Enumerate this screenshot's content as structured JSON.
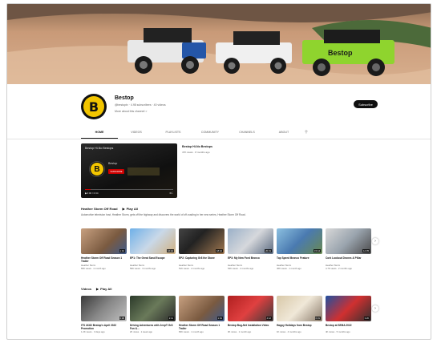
{
  "channel": {
    "name": "Bestop",
    "meta": "@bestoptv · 4.98 subscribers · 40 videos",
    "more": "More about this channel >",
    "subscribe_label": "Subscribe",
    "logo_letter": "B"
  },
  "tabs": [
    "HOME",
    "VIDEOS",
    "PLAYLISTS",
    "COMMUNITY",
    "CHANNELS",
    "ABOUT"
  ],
  "featured": {
    "overlay_title": "Bestop Hi-No Bestops",
    "channel_label": "Bestop",
    "subscribe_label": "SUBSCRIBE",
    "progress": 0.06,
    "time": "0:00 / 0:34",
    "info_title": "Bestop Hi-No Bestops",
    "info_meta": "47K views · 8 months ago"
  },
  "section1": {
    "title": "Heather Storm Off Road",
    "play_all": "Play All",
    "description": "Automotive television host, Heather Storm, gets off the highway and discovers the world of off-roading in her new series, Heather Storm Off Road."
  },
  "section2": {
    "title": "Videos",
    "play_all": "Play All"
  },
  "row1": [
    {
      "title": "Heather Storm Off Road Season 1 Trailer",
      "channel": "Heather Storm",
      "meta": "83K views · 1 month ago",
      "duration": "1:01"
    },
    {
      "title": "EP1: The Great Sand Escape",
      "channel": "Heather Storm",
      "meta": "59K views · 3 months ago",
      "duration": "16:42"
    },
    {
      "title": "EP2: Capturing Gr8 the Stone",
      "channel": "Heather Storm",
      "meta": "51K views · 2 months ago",
      "duration": "18:10"
    },
    {
      "title": "EP3: My New Ford Bronco",
      "channel": "Heather Storm",
      "meta": "54K views · 2 months ago",
      "duration": "20:31"
    },
    {
      "title": "Top Speed Bronco Feature",
      "channel": "Heather Storm",
      "meta": "45K views · 1 month ago",
      "duration": "15:44"
    },
    {
      "title": "Cork Lookout Drones & Pillar",
      "channel": "Heather Storm",
      "meta": "4.7K views · 2 months ago",
      "duration": "12:05"
    }
  ],
  "row2": [
    {
      "title": "ITS 4X4D Bestop's April 2022 Promotion",
      "channel": "",
      "meta": "1.2K views · 3 days ago",
      "duration": "0:48"
    },
    {
      "title": "Driving Adventures with Jeep® Gr8 Fun &...",
      "channel": "",
      "meta": "2K views · 1 week ago",
      "duration": "2:11"
    },
    {
      "title": "Heather Storm Off Road Season 1 Trailer",
      "channel": "",
      "meta": "83K views · 1 month ago",
      "duration": "1:01"
    },
    {
      "title": "Bestop Bug-Net Installation Video",
      "channel": "",
      "meta": "3K views · 1 month ago",
      "duration": "4:12"
    },
    {
      "title": "Happy Holidays from Bestop",
      "channel": "",
      "meta": "1K views · 4 months ago",
      "duration": "0:31"
    },
    {
      "title": "Bestop at SEMA 2022",
      "channel": "",
      "meta": "4K views · 5 months ago",
      "duration": "3:20"
    }
  ],
  "colors": {
    "brand_yellow": "#f2c500",
    "subscribe_red": "#cc0000",
    "dark": "#0f0f0f"
  }
}
